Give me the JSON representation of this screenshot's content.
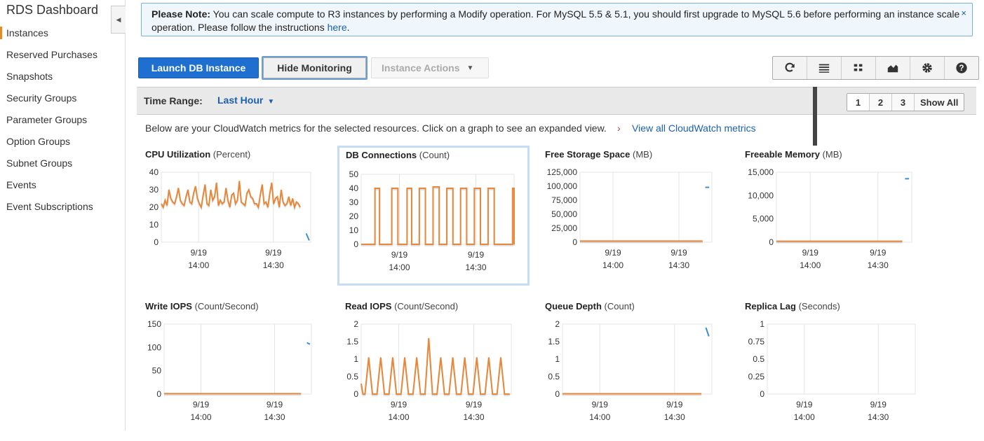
{
  "sidebar": {
    "title": "RDS Dashboard",
    "items": [
      {
        "label": "Instances",
        "active": true
      },
      {
        "label": "Reserved Purchases"
      },
      {
        "label": "Snapshots"
      },
      {
        "label": "Security Groups"
      },
      {
        "label": "Parameter Groups"
      },
      {
        "label": "Option Groups"
      },
      {
        "label": "Subnet Groups"
      },
      {
        "label": "Events"
      },
      {
        "label": "Event Subscriptions"
      }
    ],
    "collapse_glyph": "◀"
  },
  "notice": {
    "bold": "Please Note:",
    "text": " You can scale compute to R3 instances by performing a Modify operation. For MySQL 5.5 & 5.1, you should first upgrade to MySQL 5.6 before performing an instance scale operation. Please follow the instructions ",
    "link": "here",
    "tail": ".",
    "close": "×"
  },
  "toolbar": {
    "launch": "Launch DB Instance",
    "hide_monitoring": "Hide Monitoring",
    "instance_actions": "Instance Actions",
    "icons": [
      "refresh-icon",
      "list-icon",
      "grid-icon",
      "area-chart-icon",
      "gear-icon",
      "help-icon"
    ]
  },
  "time_range": {
    "label": "Time Range:",
    "value": "Last Hour",
    "pages": [
      "1",
      "2",
      "3",
      "Show All"
    ]
  },
  "cloudwatch": {
    "text": "Below are your CloudWatch metrics for the selected resources. Click on a graph to see an expanded view.",
    "arrow": "›",
    "link": "View all CloudWatch metrics"
  },
  "colors": {
    "series": "#e8873a",
    "series_blue": "#3b8ed8",
    "accent": "#1f6fd0",
    "grid": "#e4e4e4"
  },
  "chart_data": [
    {
      "type": "line",
      "title": "CPU Utilization",
      "unit": "(Percent)",
      "ylim": [
        0,
        40
      ],
      "yticks": [
        "0",
        "10",
        "20",
        "30",
        "40"
      ],
      "xticks": [
        {
          "date": "9/19",
          "time": "14:00"
        },
        {
          "date": "9/19",
          "time": "14:30"
        }
      ],
      "series": [
        {
          "values": [
            22,
            20,
            24,
            21,
            30,
            25,
            23,
            22,
            26,
            31,
            24,
            22,
            21,
            26,
            30,
            23,
            22,
            28,
            32,
            25,
            22,
            20,
            27,
            33,
            22,
            21,
            30,
            24,
            26,
            34,
            21,
            24,
            22,
            23,
            31,
            24,
            20,
            27,
            28,
            22,
            24,
            35,
            23,
            22,
            21,
            28,
            30,
            26,
            25,
            22,
            22,
            20,
            27,
            33,
            22,
            23,
            20,
            28,
            34,
            22,
            25,
            26,
            20,
            30,
            23,
            21,
            22,
            26,
            21,
            25,
            20,
            23,
            22,
            20
          ],
          "x_start_frac": 0.0,
          "x_end_frac": 0.93
        }
      ],
      "stray": {
        "x_frac": [
          0.97,
          0.99
        ],
        "values": [
          5,
          1
        ]
      }
    },
    {
      "type": "line",
      "title": "DB Connections",
      "unit": "(Count)",
      "ylim": [
        0,
        50
      ],
      "yticks": [
        "0",
        "10",
        "20",
        "30",
        "40",
        "50"
      ],
      "xticks": [
        {
          "date": "9/19",
          "time": "14:00"
        },
        {
          "date": "9/19",
          "time": "14:30"
        }
      ],
      "square": {
        "high": 40,
        "low": 0,
        "pulses": [
          [
            0.09,
            0.12
          ],
          [
            0.2,
            0.24
          ],
          [
            0.3,
            0.33
          ],
          [
            0.38,
            0.42
          ],
          [
            0.47,
            0.51
          ],
          [
            0.56,
            0.6
          ],
          [
            0.65,
            0.69
          ],
          [
            0.74,
            0.78
          ],
          [
            0.83,
            0.87
          ],
          [
            0.99,
            1.0
          ]
        ],
        "highs": [
          40,
          40,
          40,
          40,
          41,
          40,
          40,
          40,
          40,
          40
        ]
      }
    },
    {
      "type": "line",
      "title": "Free Storage Space",
      "unit": "(MB)",
      "ylim": [
        0,
        125000
      ],
      "yticks": [
        "0",
        "25,000",
        "50,000",
        "75,000",
        "100,000",
        "125,000"
      ],
      "xticks": [
        {
          "date": "9/19",
          "time": "14:00"
        },
        {
          "date": "9/19",
          "time": "14:30"
        }
      ],
      "flat_value": 2000,
      "stray": {
        "x_frac": [
          0.95,
          0.98
        ],
        "values": [
          98000,
          98000
        ]
      }
    },
    {
      "type": "line",
      "title": "Freeable Memory",
      "unit": "(MB)",
      "ylim": [
        0,
        15000
      ],
      "yticks": [
        "0",
        "5,000",
        "10,000",
        "15,000"
      ],
      "xticks": [
        {
          "date": "9/19",
          "time": "14:00"
        },
        {
          "date": "9/19",
          "time": "14:30"
        }
      ],
      "flat_value": 200,
      "stray": {
        "x_frac": [
          0.95,
          0.98
        ],
        "values": [
          13600,
          13600
        ]
      }
    },
    {
      "type": "line",
      "title": "Write IOPS",
      "unit": "(Count/Second)",
      "ylim": [
        0,
        150
      ],
      "yticks": [
        "0",
        "50",
        "100",
        "150"
      ],
      "xticks": [
        {
          "date": "9/19",
          "time": "14:00"
        },
        {
          "date": "9/19",
          "time": "14:30"
        }
      ],
      "flat_value": 1,
      "stray": {
        "x_frac": [
          0.97,
          0.99
        ],
        "values": [
          110,
          107
        ]
      }
    },
    {
      "type": "line",
      "title": "Read IOPS",
      "unit": "(Count/Second)",
      "ylim": [
        0,
        2
      ],
      "yticks": [
        "0",
        "0.5",
        "1",
        "1.5",
        "2"
      ],
      "xticks": [
        {
          "date": "9/19",
          "time": "14:00"
        },
        {
          "date": "9/19",
          "time": "14:30"
        }
      ],
      "spikes": {
        "positions": [
          0.0,
          0.05,
          0.13,
          0.21,
          0.29,
          0.37,
          0.45,
          0.53,
          0.61,
          0.69,
          0.77,
          0.85,
          0.93
        ],
        "heights": [
          0.3,
          1.05,
          1.05,
          1.05,
          1.05,
          1.05,
          1.6,
          1.05,
          1.05,
          1.05,
          1.05,
          1.05,
          1.05
        ]
      }
    },
    {
      "type": "line",
      "title": "Queue Depth",
      "unit": "(Count)",
      "ylim": [
        0,
        2
      ],
      "yticks": [
        "0",
        "0.5",
        "1",
        "1.5",
        "2"
      ],
      "xticks": [
        {
          "date": "9/19",
          "time": "14:00"
        },
        {
          "date": "9/19",
          "time": "14:30"
        }
      ],
      "flat_value": 0.01,
      "stray": {
        "x_frac": [
          0.96,
          0.98
        ],
        "values": [
          1.9,
          1.65
        ]
      }
    },
    {
      "type": "line",
      "title": "Replica Lag",
      "unit": "(Seconds)",
      "ylim": [
        0,
        1
      ],
      "yticks": [
        "0",
        "0.25",
        "0.5",
        "0.75",
        "1"
      ],
      "xticks": [
        {
          "date": "9/19",
          "time": "14:00"
        },
        {
          "date": "9/19",
          "time": "14:30"
        }
      ]
    }
  ]
}
